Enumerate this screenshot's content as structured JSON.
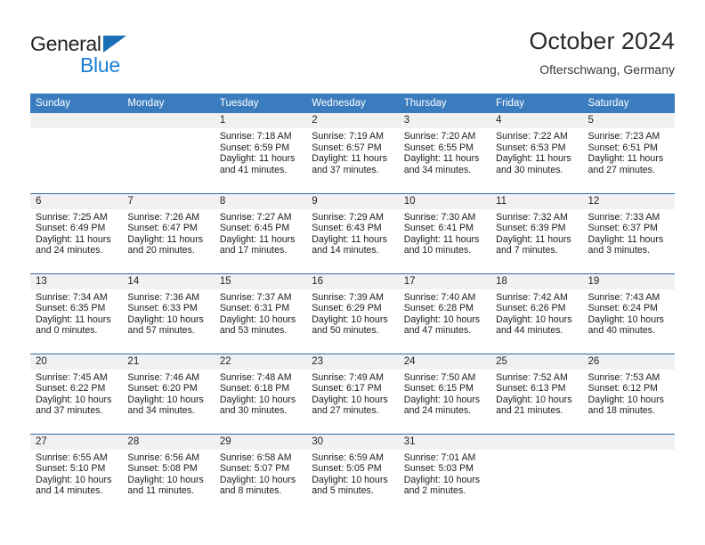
{
  "brand": {
    "name_part1": "General",
    "name_part2": "Blue",
    "triangle_color": "#1a6fb4",
    "blue_color": "#1a7fd4"
  },
  "header": {
    "title": "October 2024",
    "subtitle": "Ofterschwang, Germany"
  },
  "theme": {
    "header_blue": "#3a7cbe",
    "separator_blue": "#2e6da4",
    "daynum_band": "#f1f1f1"
  },
  "calendar": {
    "weekday_headers": [
      "Sunday",
      "Monday",
      "Tuesday",
      "Wednesday",
      "Thursday",
      "Friday",
      "Saturday"
    ],
    "weeks": [
      [
        {
          "empty": true
        },
        {
          "empty": true
        },
        {
          "day": "1",
          "sunrise": "Sunrise: 7:18 AM",
          "sunset": "Sunset: 6:59 PM",
          "daylight_line1": "Daylight: 11 hours",
          "daylight_line2": "and 41 minutes."
        },
        {
          "day": "2",
          "sunrise": "Sunrise: 7:19 AM",
          "sunset": "Sunset: 6:57 PM",
          "daylight_line1": "Daylight: 11 hours",
          "daylight_line2": "and 37 minutes."
        },
        {
          "day": "3",
          "sunrise": "Sunrise: 7:20 AM",
          "sunset": "Sunset: 6:55 PM",
          "daylight_line1": "Daylight: 11 hours",
          "daylight_line2": "and 34 minutes."
        },
        {
          "day": "4",
          "sunrise": "Sunrise: 7:22 AM",
          "sunset": "Sunset: 6:53 PM",
          "daylight_line1": "Daylight: 11 hours",
          "daylight_line2": "and 30 minutes."
        },
        {
          "day": "5",
          "sunrise": "Sunrise: 7:23 AM",
          "sunset": "Sunset: 6:51 PM",
          "daylight_line1": "Daylight: 11 hours",
          "daylight_line2": "and 27 minutes."
        }
      ],
      [
        {
          "day": "6",
          "sunrise": "Sunrise: 7:25 AM",
          "sunset": "Sunset: 6:49 PM",
          "daylight_line1": "Daylight: 11 hours",
          "daylight_line2": "and 24 minutes."
        },
        {
          "day": "7",
          "sunrise": "Sunrise: 7:26 AM",
          "sunset": "Sunset: 6:47 PM",
          "daylight_line1": "Daylight: 11 hours",
          "daylight_line2": "and 20 minutes."
        },
        {
          "day": "8",
          "sunrise": "Sunrise: 7:27 AM",
          "sunset": "Sunset: 6:45 PM",
          "daylight_line1": "Daylight: 11 hours",
          "daylight_line2": "and 17 minutes."
        },
        {
          "day": "9",
          "sunrise": "Sunrise: 7:29 AM",
          "sunset": "Sunset: 6:43 PM",
          "daylight_line1": "Daylight: 11 hours",
          "daylight_line2": "and 14 minutes."
        },
        {
          "day": "10",
          "sunrise": "Sunrise: 7:30 AM",
          "sunset": "Sunset: 6:41 PM",
          "daylight_line1": "Daylight: 11 hours",
          "daylight_line2": "and 10 minutes."
        },
        {
          "day": "11",
          "sunrise": "Sunrise: 7:32 AM",
          "sunset": "Sunset: 6:39 PM",
          "daylight_line1": "Daylight: 11 hours",
          "daylight_line2": "and 7 minutes."
        },
        {
          "day": "12",
          "sunrise": "Sunrise: 7:33 AM",
          "sunset": "Sunset: 6:37 PM",
          "daylight_line1": "Daylight: 11 hours",
          "daylight_line2": "and 3 minutes."
        }
      ],
      [
        {
          "day": "13",
          "sunrise": "Sunrise: 7:34 AM",
          "sunset": "Sunset: 6:35 PM",
          "daylight_line1": "Daylight: 11 hours",
          "daylight_line2": "and 0 minutes."
        },
        {
          "day": "14",
          "sunrise": "Sunrise: 7:36 AM",
          "sunset": "Sunset: 6:33 PM",
          "daylight_line1": "Daylight: 10 hours",
          "daylight_line2": "and 57 minutes."
        },
        {
          "day": "15",
          "sunrise": "Sunrise: 7:37 AM",
          "sunset": "Sunset: 6:31 PM",
          "daylight_line1": "Daylight: 10 hours",
          "daylight_line2": "and 53 minutes."
        },
        {
          "day": "16",
          "sunrise": "Sunrise: 7:39 AM",
          "sunset": "Sunset: 6:29 PM",
          "daylight_line1": "Daylight: 10 hours",
          "daylight_line2": "and 50 minutes."
        },
        {
          "day": "17",
          "sunrise": "Sunrise: 7:40 AM",
          "sunset": "Sunset: 6:28 PM",
          "daylight_line1": "Daylight: 10 hours",
          "daylight_line2": "and 47 minutes."
        },
        {
          "day": "18",
          "sunrise": "Sunrise: 7:42 AM",
          "sunset": "Sunset: 6:26 PM",
          "daylight_line1": "Daylight: 10 hours",
          "daylight_line2": "and 44 minutes."
        },
        {
          "day": "19",
          "sunrise": "Sunrise: 7:43 AM",
          "sunset": "Sunset: 6:24 PM",
          "daylight_line1": "Daylight: 10 hours",
          "daylight_line2": "and 40 minutes."
        }
      ],
      [
        {
          "day": "20",
          "sunrise": "Sunrise: 7:45 AM",
          "sunset": "Sunset: 6:22 PM",
          "daylight_line1": "Daylight: 10 hours",
          "daylight_line2": "and 37 minutes."
        },
        {
          "day": "21",
          "sunrise": "Sunrise: 7:46 AM",
          "sunset": "Sunset: 6:20 PM",
          "daylight_line1": "Daylight: 10 hours",
          "daylight_line2": "and 34 minutes."
        },
        {
          "day": "22",
          "sunrise": "Sunrise: 7:48 AM",
          "sunset": "Sunset: 6:18 PM",
          "daylight_line1": "Daylight: 10 hours",
          "daylight_line2": "and 30 minutes."
        },
        {
          "day": "23",
          "sunrise": "Sunrise: 7:49 AM",
          "sunset": "Sunset: 6:17 PM",
          "daylight_line1": "Daylight: 10 hours",
          "daylight_line2": "and 27 minutes."
        },
        {
          "day": "24",
          "sunrise": "Sunrise: 7:50 AM",
          "sunset": "Sunset: 6:15 PM",
          "daylight_line1": "Daylight: 10 hours",
          "daylight_line2": "and 24 minutes."
        },
        {
          "day": "25",
          "sunrise": "Sunrise: 7:52 AM",
          "sunset": "Sunset: 6:13 PM",
          "daylight_line1": "Daylight: 10 hours",
          "daylight_line2": "and 21 minutes."
        },
        {
          "day": "26",
          "sunrise": "Sunrise: 7:53 AM",
          "sunset": "Sunset: 6:12 PM",
          "daylight_line1": "Daylight: 10 hours",
          "daylight_line2": "and 18 minutes."
        }
      ],
      [
        {
          "day": "27",
          "sunrise": "Sunrise: 6:55 AM",
          "sunset": "Sunset: 5:10 PM",
          "daylight_line1": "Daylight: 10 hours",
          "daylight_line2": "and 14 minutes."
        },
        {
          "day": "28",
          "sunrise": "Sunrise: 6:56 AM",
          "sunset": "Sunset: 5:08 PM",
          "daylight_line1": "Daylight: 10 hours",
          "daylight_line2": "and 11 minutes."
        },
        {
          "day": "29",
          "sunrise": "Sunrise: 6:58 AM",
          "sunset": "Sunset: 5:07 PM",
          "daylight_line1": "Daylight: 10 hours",
          "daylight_line2": "and 8 minutes."
        },
        {
          "day": "30",
          "sunrise": "Sunrise: 6:59 AM",
          "sunset": "Sunset: 5:05 PM",
          "daylight_line1": "Daylight: 10 hours",
          "daylight_line2": "and 5 minutes."
        },
        {
          "day": "31",
          "sunrise": "Sunrise: 7:01 AM",
          "sunset": "Sunset: 5:03 PM",
          "daylight_line1": "Daylight: 10 hours",
          "daylight_line2": "and 2 minutes."
        },
        {
          "empty": true
        },
        {
          "empty": true
        }
      ]
    ]
  }
}
